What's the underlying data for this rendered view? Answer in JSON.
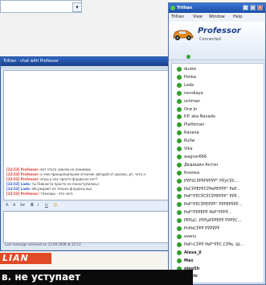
{
  "background": {
    "dropdown_arrow": "▾"
  },
  "chat": {
    "title": "Trillian - chat with Professor",
    "messages": [
      {
        "nick": "[22:53] Professor:",
        "text": " вот этого совсем не понимаю",
        "color": "#d83a2a"
      },
      {
        "nick": "[22:53] Professor:",
        "text": " а чем принципиальное отличие звёздей от досока, дт, чего н",
        "color": "#d83a2a"
      },
      {
        "nick": "[22:53] Professor:",
        "text": " игры у нас просто флудеска нет?",
        "color": "#d83a2a"
      },
      {
        "nick": "[22:53] Lada:",
        "text": " ты Пивности просто не понаступилась)",
        "color": "#2a57c8"
      },
      {
        "nick": "[22:53] Lada:",
        "text": " обсуждают не только флудесы вы)",
        "color": "#2a57c8"
      },
      {
        "nick": "[22:53] Professor:",
        "text": " тпаноиш - это чего",
        "color": "#d83a2a"
      }
    ],
    "toolbar": {
      "a": "A",
      "a_small": "A",
      "a_down": "A▾",
      "bold": "B",
      "italic": "I",
      "underline": "U",
      "emoticon": "☺"
    },
    "status": "Last message received on 23.09.2008 at 22:53"
  },
  "trillian": {
    "title": "Trillian",
    "buttons": {
      "minimize": "_",
      "maximize": "□",
      "close": "✕"
    },
    "menu": [
      "Trillian",
      "View",
      "Window",
      "Help"
    ],
    "profile": {
      "name": "Professor",
      "status": "Connected"
    },
    "contacts": [
      "duxko",
      "Ponka",
      "Lada",
      "nevskaya",
      "ochman",
      "One Jn",
      "P.P. aka Nevada",
      "Plattkman",
      "Ravana",
      "Rullw",
      "Vika",
      "wagner666",
      "Дедишин Антон",
      "Кнопка",
      "PЎPSCЎPЎPЎPЎP° PЎyCЎC...",
      "PeCЎPEPЎCЎPePEPЎP° PeP...",
      "PeP°PЎCЎCЎCЎPEPЎP° PЎP...",
      "PeP°PЎCЎPEPЎP° PЎPEPЎPЎ...",
      "PeP°PЎPEPЎ PeP°PЎPЎ...",
      "PEPµC..PЎPµPЎPEPЎ PЎPЎC...",
      "PnPeCЎPP PЎPЎPЎ",
      "avenu",
      "PeP»CЎPЎ PeP°PЎC,CЎPe, Ш...",
      "Alexa_Ji",
      "Max",
      "olegSh",
      "Protiv"
    ],
    "bold_contacts": [
      "Alexa_Ji",
      "Max",
      "olegSh",
      "Protiv"
    ]
  },
  "overlay": {
    "banner": "LIAN",
    "caption": "в. не уступает"
  },
  "colors": {
    "online": "#2fa02f",
    "titlebar": "#1b4ea8",
    "accent": "#e04a27"
  }
}
